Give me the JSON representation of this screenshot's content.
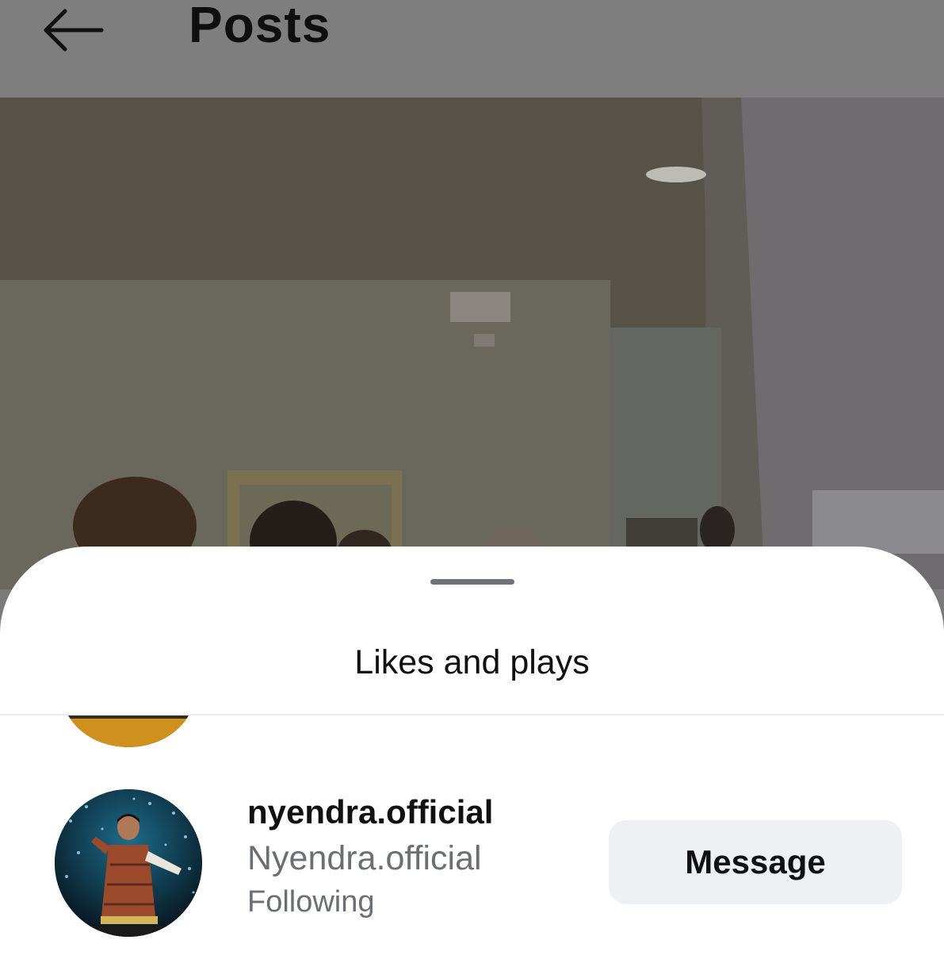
{
  "header": {
    "title": "Posts",
    "back_icon": "arrow-left-icon"
  },
  "sheet": {
    "title": "Likes and plays"
  },
  "users": [
    {
      "username": "nyendra.official",
      "full_name": "Nyendra.official",
      "status": "Following",
      "action_label": "Message"
    }
  ],
  "colors": {
    "overlay": "#7a7a7a",
    "sheet_bg": "#ffffff",
    "button_bg": "#eff0f4",
    "secondary_text": "#6b6e73"
  }
}
